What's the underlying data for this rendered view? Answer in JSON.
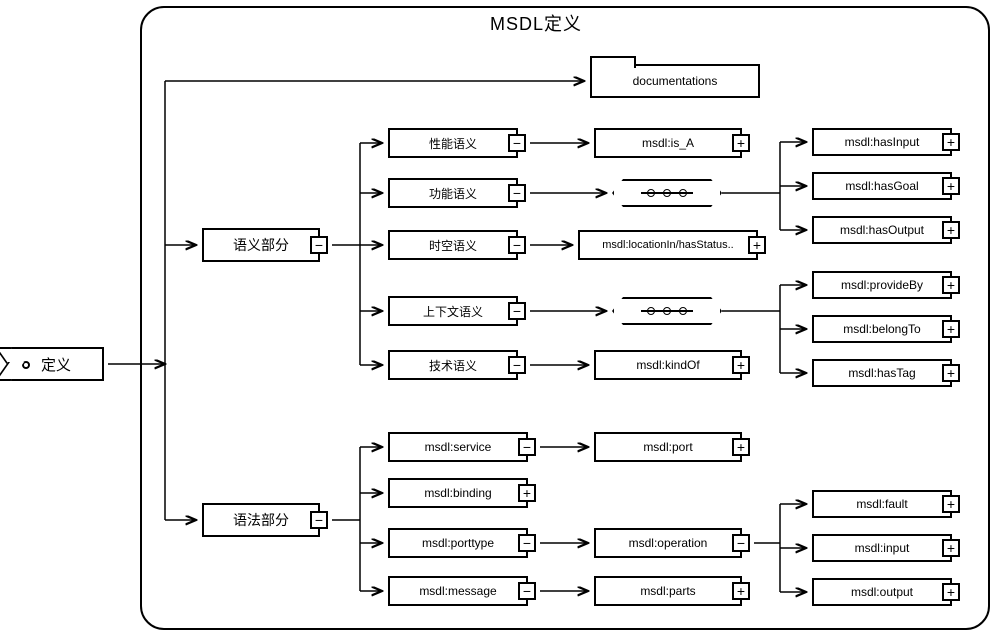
{
  "title": "MSDL定义",
  "root": "定义",
  "documentations": "documentations",
  "semantic_section": "语义部分",
  "syntax_section": "语法部分",
  "semantic": {
    "perf": "性能语义",
    "func": "功能语义",
    "spatiotemporal": "时空语义",
    "context": "上下文语义",
    "tech": "技术语义"
  },
  "sem_nodes": {
    "is_a": "msdl:is_A",
    "loc": "msdl:locationIn/hasStatus..",
    "kindof": "msdl:kindOf",
    "hasInput": "msdl:hasInput",
    "hasGoal": "msdl:hasGoal",
    "hasOutput": "msdl:hasOutput",
    "provideBy": "msdl:provideBy",
    "belongTo": "msdl:belongTo",
    "hasTag": "msdl:hasTag"
  },
  "syntax": {
    "service": "msdl:service",
    "binding": "msdl:binding",
    "porttype": "msdl:porttype",
    "message": "msdl:message",
    "port": "msdl:port",
    "operation": "msdl:operation",
    "parts": "msdl:parts",
    "fault": "msdl:fault",
    "input": "msdl:input",
    "output": "msdl:output"
  },
  "glyph_plus": "+",
  "glyph_minus": "−"
}
